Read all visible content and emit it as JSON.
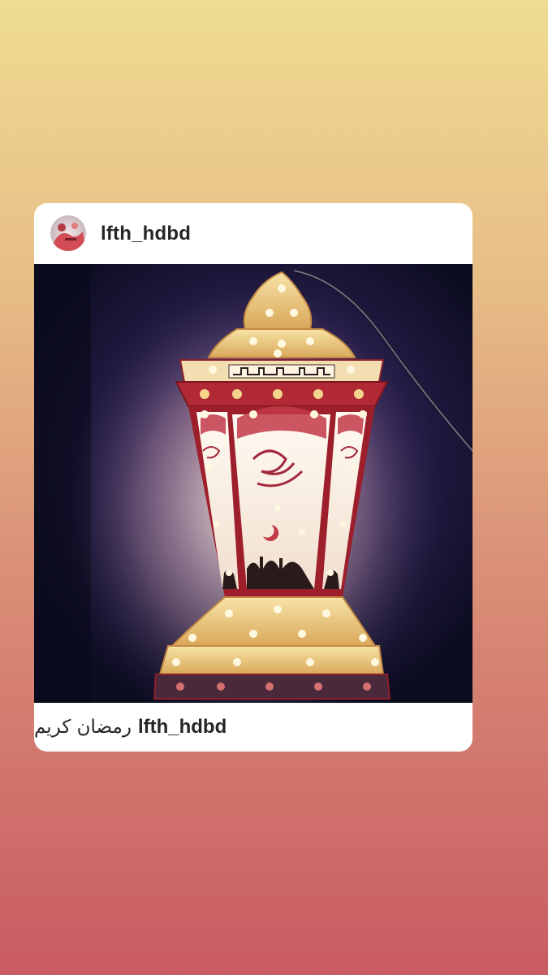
{
  "post": {
    "username": "lfth_hdbd",
    "avatar_icon": "profile-avatar",
    "photo_subject": "ramadan-lantern-icon",
    "caption_username": "lfth_hdbd",
    "caption_text": "رمضان كريم"
  },
  "colors": {
    "background_top": "#efdc92",
    "background_bottom": "#c95b62",
    "card": "#ffffff",
    "text": "#262626"
  }
}
